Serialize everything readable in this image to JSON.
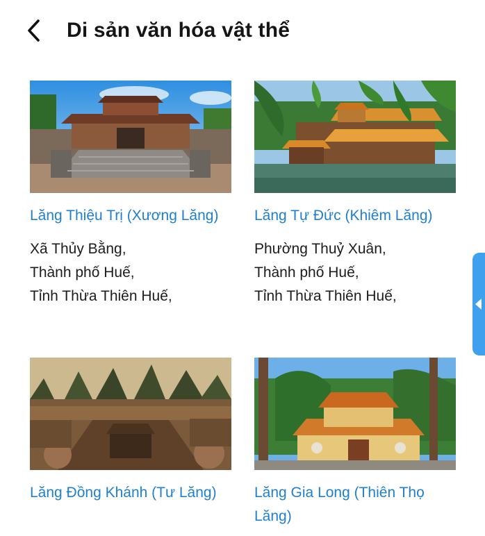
{
  "header": {
    "back_icon": "chevron-left-icon",
    "title": "Di sản văn hóa vật thể"
  },
  "cards": [
    {
      "title": "Lăng Thiệu Trị (Xương Lăng)",
      "address": [
        "Xã Thủy Bằng,",
        "Thành phố Huế,",
        "Tỉnh Thừa Thiên Huế,"
      ]
    },
    {
      "title": "Lăng Tự Đức (Khiêm Lăng)",
      "address": [
        "Phường Thuỷ Xuân,",
        "Thành phố Huế,",
        "Tỉnh Thừa Thiên Huế,"
      ]
    },
    {
      "title": "Lăng Đồng Khánh (Tư Lăng)",
      "address": []
    },
    {
      "title": "Lăng Gia Long (Thiên Thọ Lăng)",
      "address": []
    }
  ],
  "colors": {
    "link": "#1f7fd0",
    "side_tab": "#3fa0ee"
  },
  "side_tab": {
    "icon": "caret-left-icon"
  }
}
